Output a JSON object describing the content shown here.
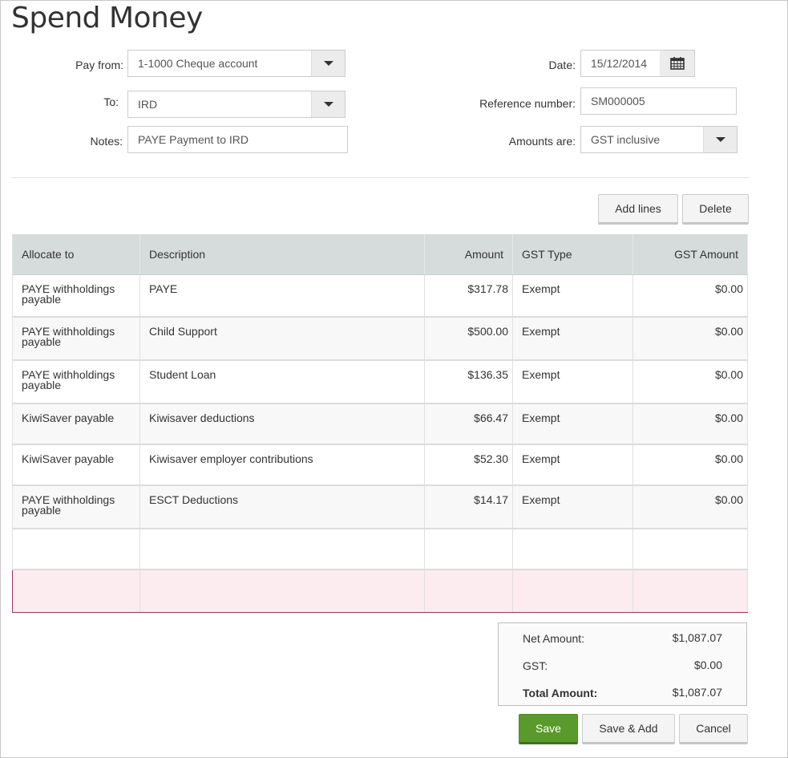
{
  "page": {
    "title": "Spend Money"
  },
  "form": {
    "pay_from_label": "Pay from:",
    "pay_from_value": "1-1000 Cheque account",
    "to_label": "To:",
    "to_value": "IRD",
    "notes_label": "Notes:",
    "notes_value": "PAYE Payment to IRD",
    "date_label": "Date:",
    "date_value": "15/12/2014",
    "reference_label": "Reference number:",
    "reference_value": "SM000005",
    "amounts_are_label": "Amounts are:",
    "amounts_are_value": "GST inclusive"
  },
  "icons": {
    "calendar": "calendar-icon",
    "dropdown": "chevron-down-icon"
  },
  "toolbar": {
    "add_lines": "Add lines",
    "delete": "Delete"
  },
  "table": {
    "headers": [
      "Allocate to",
      "Description",
      "Amount",
      "GST Type",
      "GST Amount"
    ],
    "rows": [
      {
        "allocate_to": "PAYE withholdings payable",
        "description": "PAYE",
        "amount": "$317.78",
        "gst_type": "Exempt",
        "gst_amount": "$0.00"
      },
      {
        "allocate_to": "PAYE withholdings payable",
        "description": "Child Support",
        "amount": "$500.00",
        "gst_type": "Exempt",
        "gst_amount": "$0.00"
      },
      {
        "allocate_to": "PAYE withholdings payable",
        "description": "Student Loan",
        "amount": "$136.35",
        "gst_type": "Exempt",
        "gst_amount": "$0.00"
      },
      {
        "allocate_to": "KiwiSaver payable",
        "description": "Kiwisaver deductions",
        "amount": "$66.47",
        "gst_type": "Exempt",
        "gst_amount": "$0.00"
      },
      {
        "allocate_to": "KiwiSaver payable",
        "description": "Kiwisaver employer contributions",
        "amount": "$52.30",
        "gst_type": "Exempt",
        "gst_amount": "$0.00"
      },
      {
        "allocate_to": "PAYE withholdings payable",
        "description": "ESCT Deductions",
        "amount": "$14.17",
        "gst_type": "Exempt",
        "gst_amount": "$0.00"
      }
    ]
  },
  "totals": {
    "net_label": "Net Amount:",
    "net_value": "$1,087.07",
    "gst_label": "GST:",
    "gst_value": "$0.00",
    "total_label": "Total Amount:",
    "total_value": "$1,087.07"
  },
  "actions": {
    "save": "Save",
    "save_add": "Save & Add",
    "cancel": "Cancel"
  },
  "colors": {
    "primary_button": "#5a9a2c",
    "table_header": "#d5dcdb",
    "active_row": "#fcebef",
    "active_row_border": "#a0306a"
  }
}
